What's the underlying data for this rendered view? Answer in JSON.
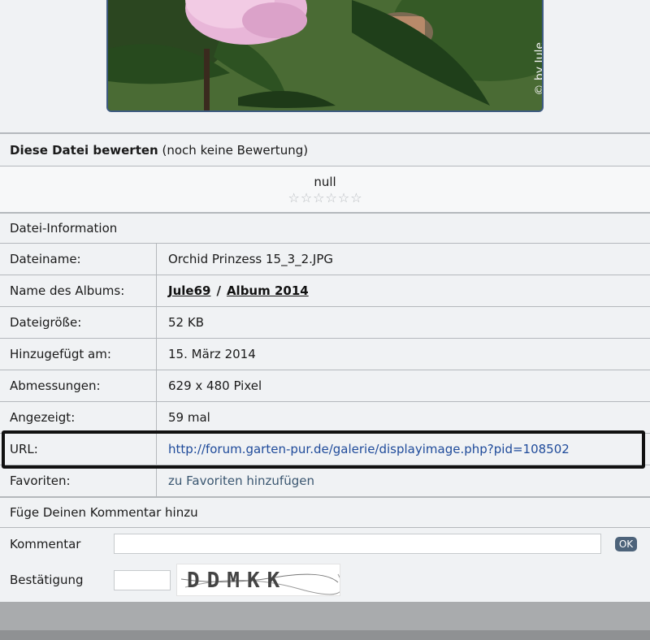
{
  "photo": {
    "watermark": "© by Jule"
  },
  "rating": {
    "title_bold": "Diese Datei bewerten",
    "title_rest": "(noch keine Bewertung)",
    "value": "null",
    "stars": [
      "☆",
      "☆",
      "☆",
      "☆",
      "☆",
      "☆"
    ]
  },
  "fileinfo": {
    "heading": "Datei-Information",
    "filename_label": "Dateiname:",
    "filename": "Orchid Prinzess 15_3_2.JPG",
    "album_label": "Name des Albums:",
    "album_user": "Jule69",
    "album_sep": "/",
    "album_name": "Album 2014",
    "size_label": "Dateigröße:",
    "size": "52 KB",
    "added_label": "Hinzugefügt am:",
    "added": "15. März 2014",
    "dims_label": "Abmessungen:",
    "dims": "629 x 480 Pixel",
    "views_label": "Angezeigt:",
    "views": "59 mal",
    "url_label": "URL:",
    "url": "http://forum.garten-pur.de/galerie/displayimage.php?pid=108502",
    "fav_label": "Favoriten:",
    "fav_link": "zu Favoriten hinzufügen"
  },
  "comment": {
    "heading": "Füge Deinen Kommentar hinzu",
    "comment_label": "Kommentar",
    "comment_value": "",
    "ok_label": "OK",
    "confirm_label": "Bestätigung",
    "confirm_value": "",
    "captcha_text": "DDMKK"
  },
  "colors": {
    "link": "#1e4a9a",
    "border": "#b4b8bc",
    "ok_button": "#4d637a"
  }
}
